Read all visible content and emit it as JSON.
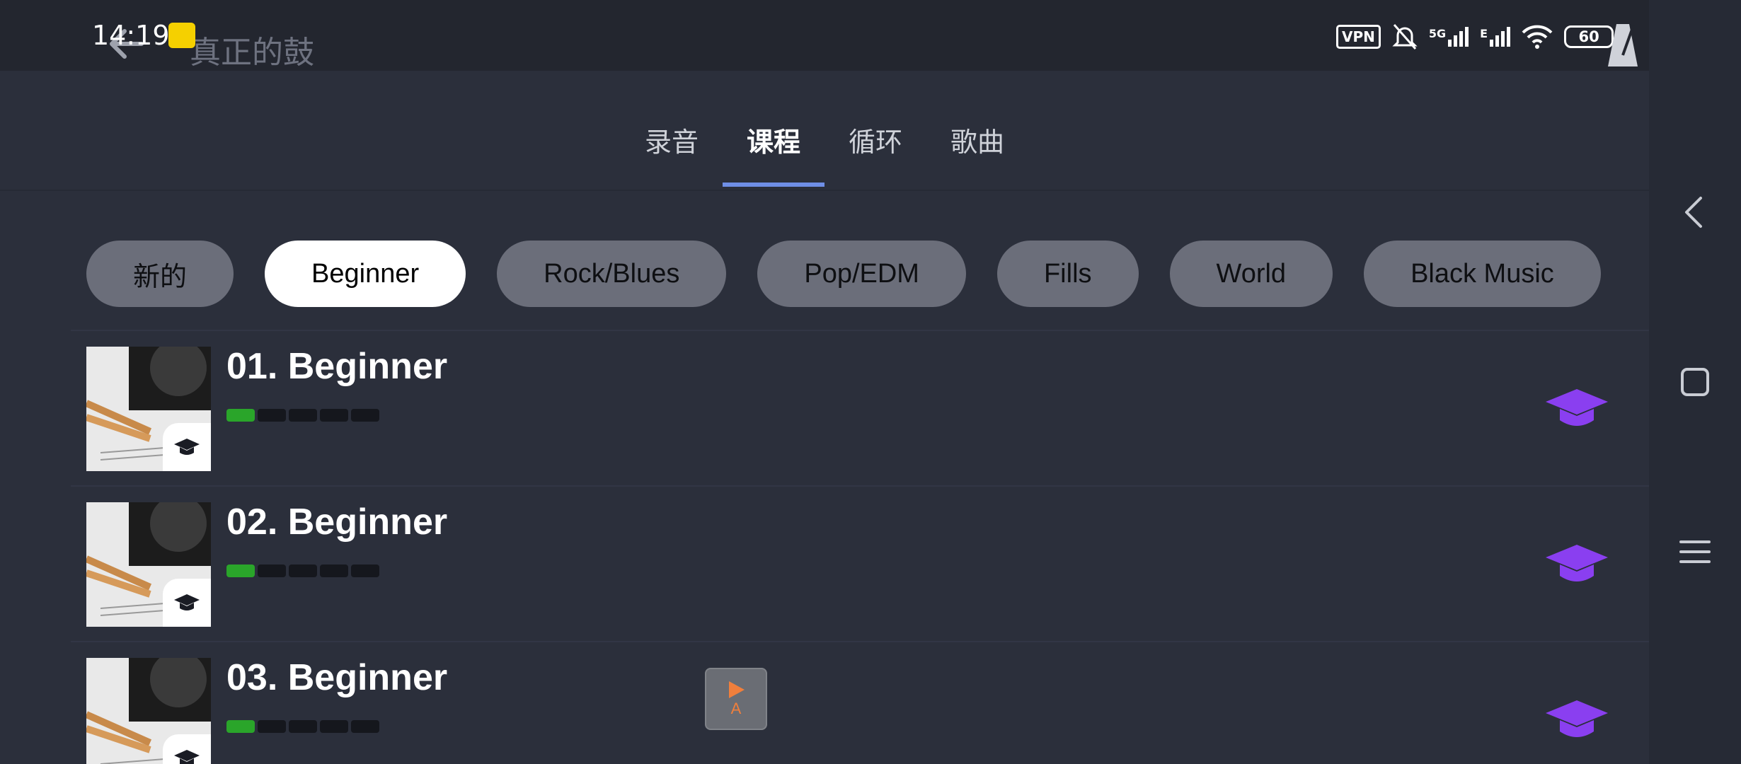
{
  "status_bar": {
    "time": "14:19",
    "vpn_label": "VPN",
    "network": "5G",
    "network_2": "E",
    "battery": "60"
  },
  "app_bar": {
    "title": "真正的鼓",
    "back_icon": "back-arrow-icon",
    "metronome_icon": "metronome-icon"
  },
  "tabs": [
    {
      "label": "录音",
      "active": false
    },
    {
      "label": "课程",
      "active": true
    },
    {
      "label": "循环",
      "active": false
    },
    {
      "label": "歌曲",
      "active": false
    }
  ],
  "chips": [
    {
      "label": "新的",
      "active": false
    },
    {
      "label": "Beginner",
      "active": true
    },
    {
      "label": "Rock/Blues",
      "active": false
    },
    {
      "label": "Pop/EDM",
      "active": false
    },
    {
      "label": "Fills",
      "active": false
    },
    {
      "label": "World",
      "active": false
    },
    {
      "label": "Black Music",
      "active": false
    }
  ],
  "lessons": [
    {
      "title": "01. Beginner",
      "progress": 0.2
    },
    {
      "title": "02. Beginner",
      "progress": 0.2
    },
    {
      "title": "03. Beginner",
      "progress": 0.2
    }
  ],
  "floating_button": {
    "label": "A",
    "icon": "play-icon"
  },
  "colors": {
    "accent_tab": "#6f8fe6",
    "progress_fill": "#2aa52a",
    "cap_purple": "#8a3ff0",
    "play_orange": "#f07f3c"
  },
  "nav_bar": {
    "icons": [
      "back-chevron-icon",
      "square-icon",
      "menu-icon"
    ]
  }
}
